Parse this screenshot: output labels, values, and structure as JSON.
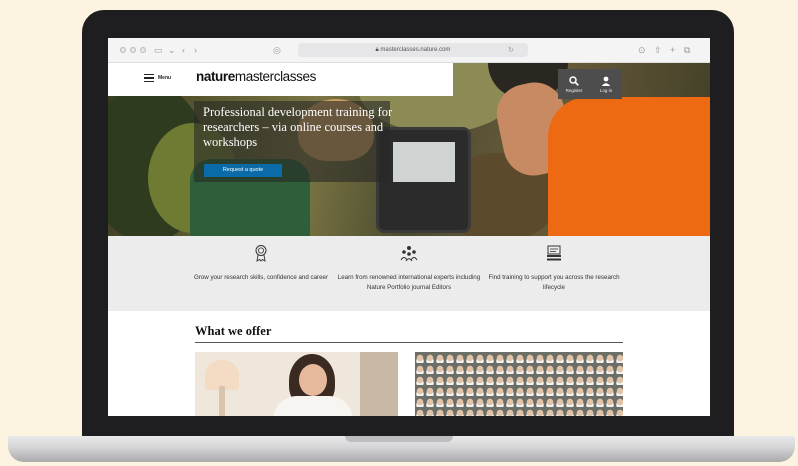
{
  "browser": {
    "address": "masterclasses.nature.com"
  },
  "site": {
    "menu_label": "Menu",
    "logo_bold": "nature",
    "logo_light": "masterclasses",
    "account": [
      {
        "label": "Register",
        "icon": "search-icon"
      },
      {
        "label": "Log in",
        "icon": "user-icon"
      }
    ]
  },
  "hero": {
    "title": "Professional development training for researchers – via online courses and workshops",
    "button_label": "Request a quote"
  },
  "features": [
    {
      "icon": "award-ribbon-icon",
      "text": "Grow your research skills, confidence and career"
    },
    {
      "icon": "group-people-icon",
      "text": "Learn from renowned international experts including Nature Portfolio journal Editors"
    },
    {
      "icon": "training-stack-icon",
      "text": "Find training to support you across the research lifecycle"
    }
  ],
  "offer": {
    "title": "What we offer"
  },
  "colors": {
    "accent_blue": "#0b6aa8",
    "account_bg": "#4d4d4d",
    "features_bg": "#ececec",
    "laptop_bezel": "#1e1e20",
    "background": "#fdf3e1"
  }
}
